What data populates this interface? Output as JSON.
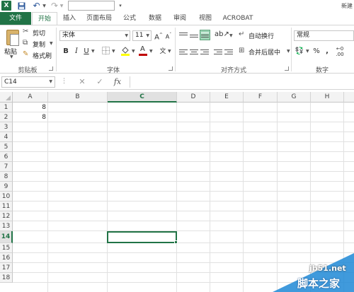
{
  "app": {
    "title_right": "新建",
    "logo_text": "X"
  },
  "quick_access": {
    "undo_icon": "undo-icon",
    "redo_icon": "redo-icon",
    "save_icon": "save-icon"
  },
  "tabs": [
    {
      "label": "文件"
    },
    {
      "label": "开始"
    },
    {
      "label": "插入"
    },
    {
      "label": "页面布局"
    },
    {
      "label": "公式"
    },
    {
      "label": "数据"
    },
    {
      "label": "审阅"
    },
    {
      "label": "视图"
    },
    {
      "label": "ACROBAT"
    }
  ],
  "ribbon": {
    "clipboard": {
      "paste": "粘贴",
      "cut": "剪切",
      "copy": "复制",
      "format_painter": "格式刷",
      "group_label": "剪贴板"
    },
    "font": {
      "font_name": "宋体",
      "font_size": "11",
      "grow": "A",
      "shrink": "A",
      "bold": "B",
      "italic": "I",
      "underline": "U",
      "font_color_letter": "A",
      "wen": "文",
      "group_label": "字体"
    },
    "alignment": {
      "wrap_text": "自动换行",
      "merge_center": "合并后居中",
      "group_label": "对齐方式"
    },
    "number": {
      "format": "常规",
      "percent": "%",
      "comma": ",",
      "group_label": "数字"
    },
    "colors": {
      "accent": "#217346",
      "highlight_yellow": "#ffff00",
      "font_red": "#c00000"
    }
  },
  "formula_bar": {
    "name_box": "C14",
    "dots": "⋮",
    "cancel_icon": "close-icon",
    "enter_icon": "check-icon",
    "fx": "fx",
    "formula": ""
  },
  "sheet": {
    "columns": [
      "A",
      "B",
      "C",
      "D",
      "E",
      "F",
      "G",
      "H"
    ],
    "rows": [
      "1",
      "2",
      "3",
      "4",
      "5",
      "6",
      "7",
      "8",
      "9",
      "10",
      "11",
      "12",
      "13",
      "14",
      "15",
      "16",
      "17",
      "18"
    ],
    "selected_column": "C",
    "selected_row": "14",
    "cells": {
      "A1": "8",
      "A2": "8"
    }
  },
  "watermark": {
    "site": "jb51.net",
    "brand": "脚本之家"
  }
}
